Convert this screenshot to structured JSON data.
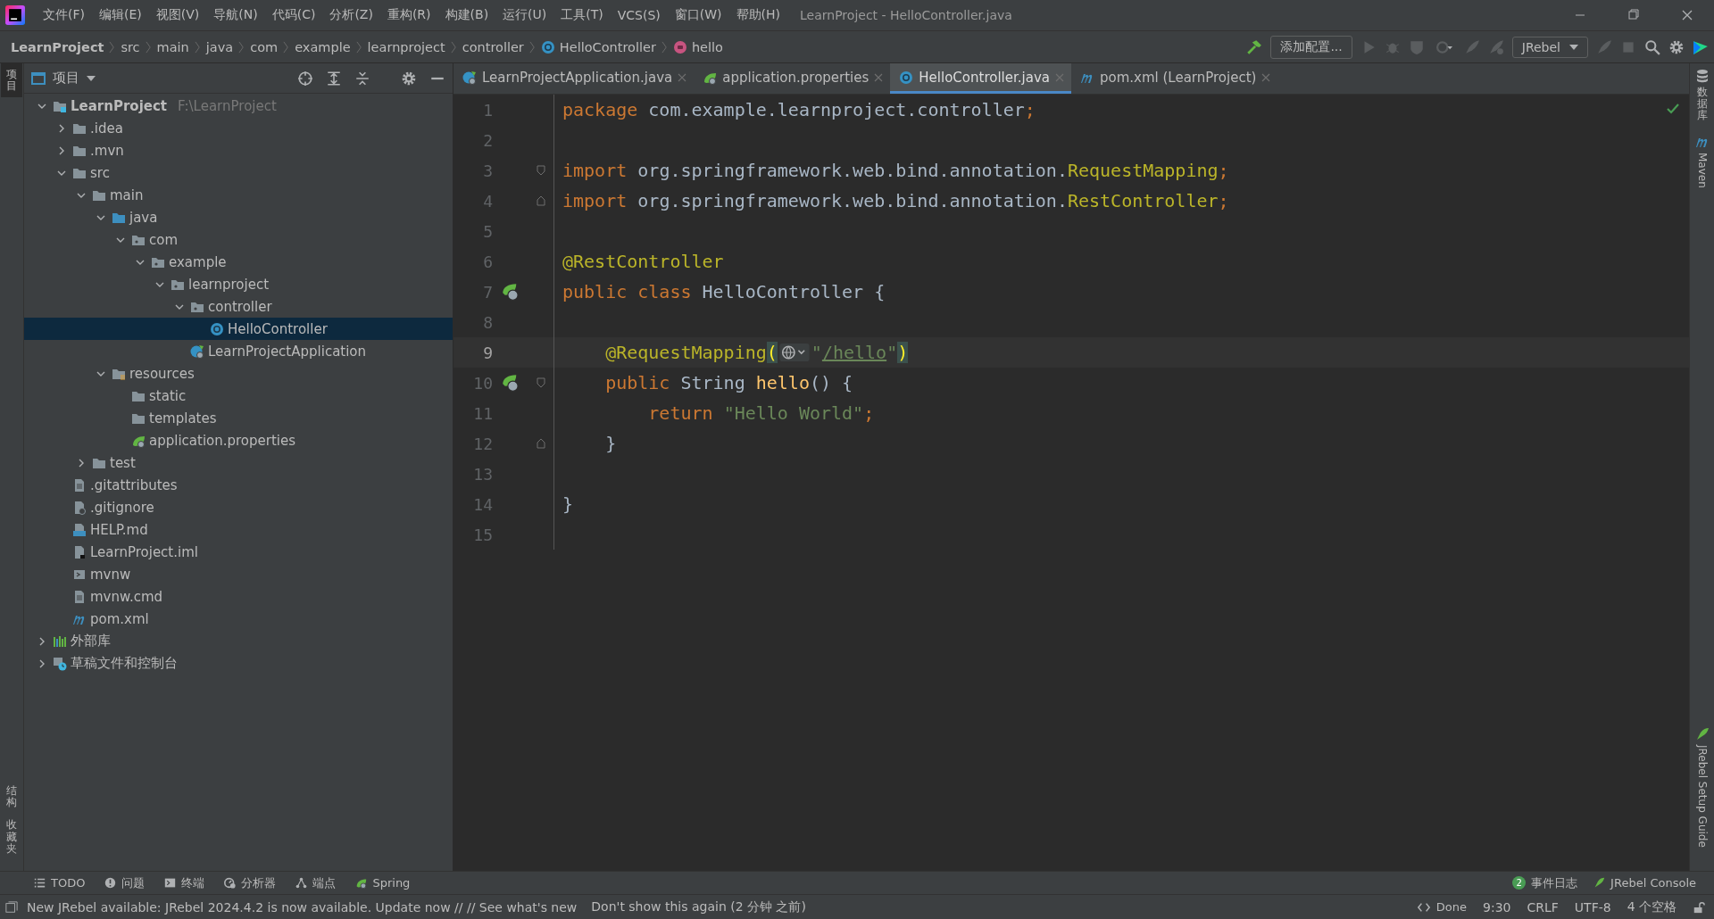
{
  "menu": [
    "文件(F)",
    "编辑(E)",
    "视图(V)",
    "导航(N)",
    "代码(C)",
    "分析(Z)",
    "重构(R)",
    "构建(B)",
    "运行(U)",
    "工具(T)",
    "VCS(S)",
    "窗口(W)",
    "帮助(H)"
  ],
  "window_title": "LearnProject - HelloController.java",
  "breadcrumbs": [
    {
      "label": "LearnProject",
      "kind": "project"
    },
    {
      "label": "src",
      "kind": "dir"
    },
    {
      "label": "main",
      "kind": "dir"
    },
    {
      "label": "java",
      "kind": "dir"
    },
    {
      "label": "com",
      "kind": "dir"
    },
    {
      "label": "example",
      "kind": "dir"
    },
    {
      "label": "learnproject",
      "kind": "dir"
    },
    {
      "label": "controller",
      "kind": "dir"
    },
    {
      "label": "HelloController",
      "kind": "class"
    },
    {
      "label": "hello",
      "kind": "method"
    }
  ],
  "toolbar": {
    "add_config": "添加配置...",
    "jrebel": "JRebel"
  },
  "left_strip_top": [
    {
      "label": "项目",
      "selected": true
    }
  ],
  "left_strip_bottom": [
    {
      "label": "结构",
      "selected": false
    },
    {
      "label": "收藏夹",
      "selected": false
    }
  ],
  "project_panel": {
    "title": "项目",
    "tree": [
      {
        "label": "LearnProject",
        "path": "F:\\LearnProject",
        "kind": "module",
        "expanded": true,
        "selected": false,
        "children": [
          {
            "label": ".idea",
            "kind": "folder",
            "expanded": false,
            "selected": false
          },
          {
            "label": ".mvn",
            "kind": "folder",
            "expanded": false,
            "selected": false
          },
          {
            "label": "src",
            "kind": "folder",
            "expanded": true,
            "selected": false,
            "children": [
              {
                "label": "main",
                "kind": "folder",
                "expanded": true,
                "selected": false,
                "children": [
                  {
                    "label": "java",
                    "kind": "source",
                    "expanded": true,
                    "selected": false,
                    "children": [
                      {
                        "label": "com",
                        "kind": "package",
                        "expanded": true,
                        "selected": false,
                        "children": [
                          {
                            "label": "example",
                            "kind": "package",
                            "expanded": true,
                            "selected": false,
                            "children": [
                              {
                                "label": "learnproject",
                                "kind": "package",
                                "expanded": true,
                                "selected": false,
                                "children": [
                                  {
                                    "label": "controller",
                                    "kind": "package",
                                    "expanded": true,
                                    "selected": false,
                                    "children": [
                                      {
                                        "label": "HelloController",
                                        "kind": "class",
                                        "selected": true
                                      }
                                    ]
                                  },
                                  {
                                    "label": "LearnProjectApplication",
                                    "kind": "spring-class",
                                    "selected": false
                                  }
                                ]
                              }
                            ]
                          }
                        ]
                      }
                    ]
                  },
                  {
                    "label": "resources",
                    "kind": "resources",
                    "expanded": true,
                    "selected": false,
                    "children": [
                      {
                        "label": "static",
                        "kind": "folder",
                        "selected": false
                      },
                      {
                        "label": "templates",
                        "kind": "folder",
                        "selected": false
                      },
                      {
                        "label": "application.properties",
                        "kind": "spring-config",
                        "selected": false
                      }
                    ]
                  }
                ]
              },
              {
                "label": "test",
                "kind": "folder",
                "expanded": false,
                "selected": false
              }
            ]
          },
          {
            "label": ".gitattributes",
            "kind": "text-file",
            "selected": false
          },
          {
            "label": ".gitignore",
            "kind": "ignore-file",
            "selected": false
          },
          {
            "label": "HELP.md",
            "kind": "md-file",
            "selected": false
          },
          {
            "label": "LearnProject.iml",
            "kind": "iml-file",
            "selected": false
          },
          {
            "label": "mvnw",
            "kind": "script-file",
            "selected": false
          },
          {
            "label": "mvnw.cmd",
            "kind": "text-file",
            "selected": false
          },
          {
            "label": "pom.xml",
            "kind": "maven-file",
            "selected": false
          }
        ]
      },
      {
        "label": "外部库",
        "kind": "library",
        "expanded": false,
        "selected": false
      },
      {
        "label": "草稿文件和控制台",
        "kind": "scratch",
        "expanded": false,
        "selected": false
      }
    ]
  },
  "tabs": [
    {
      "label": "LearnProjectApplication.java",
      "kind": "spring-class",
      "selected": false
    },
    {
      "label": "application.properties",
      "kind": "spring-config",
      "selected": false
    },
    {
      "label": "HelloController.java",
      "kind": "class",
      "selected": true
    },
    {
      "label": "pom.xml (LearnProject)",
      "kind": "maven-file",
      "selected": false
    }
  ],
  "editor": {
    "lines": [
      {
        "number": "1",
        "current": false,
        "tokens": [
          {
            "kind": "kw",
            "text": "package "
          },
          {
            "kind": "plain",
            "text": "com.example.learnproject.controller"
          },
          {
            "kind": "kw",
            "text": ";"
          }
        ]
      },
      {
        "number": "2",
        "current": false
      },
      {
        "number": "3",
        "current": false,
        "fold_start": true,
        "tokens": [
          {
            "kind": "kw",
            "text": "import "
          },
          {
            "kind": "plain",
            "text": "org.springframework.web.bind.annotation."
          },
          {
            "kind": "ann",
            "text": "RequestMapping"
          },
          {
            "kind": "kw",
            "text": ";"
          }
        ]
      },
      {
        "number": "4",
        "current": false,
        "fold_end": true,
        "tokens": [
          {
            "kind": "kw",
            "text": "import "
          },
          {
            "kind": "plain",
            "text": "org.springframework.web.bind.annotation."
          },
          {
            "kind": "ann",
            "text": "RestController"
          },
          {
            "kind": "kw",
            "text": ";"
          }
        ]
      },
      {
        "number": "5",
        "current": false
      },
      {
        "number": "6",
        "current": false,
        "tokens": [
          {
            "kind": "ann",
            "text": "@RestController"
          }
        ]
      },
      {
        "number": "7",
        "current": false,
        "bean_marker": true,
        "tokens": [
          {
            "kind": "kw",
            "text": "public class "
          },
          {
            "kind": "plain",
            "text": "HelloController {"
          }
        ]
      },
      {
        "number": "8",
        "current": false
      },
      {
        "number": "9",
        "current": true,
        "tokens": [
          {
            "kind": "ann",
            "text": "    @RequestMapping"
          },
          {
            "kind": "brace",
            "text": "("
          },
          {
            "kind": "inlay"
          },
          {
            "kind": "str",
            "text": "\""
          },
          {
            "kind": "link",
            "text": "/hello"
          },
          {
            "kind": "str",
            "text": "\""
          },
          {
            "kind": "brace",
            "text": ")"
          }
        ]
      },
      {
        "number": "10",
        "current": false,
        "bean_marker": true,
        "fold_start": true,
        "tokens": [
          {
            "kind": "kw",
            "text": "    public "
          },
          {
            "kind": "plain",
            "text": "String "
          },
          {
            "kind": "fn",
            "text": "hello"
          },
          {
            "kind": "plain",
            "text": "() {"
          }
        ]
      },
      {
        "number": "11",
        "current": false,
        "tokens": [
          {
            "kind": "kw",
            "text": "        return "
          },
          {
            "kind": "str",
            "text": "\"Hello World\""
          },
          {
            "kind": "kw",
            "text": ";"
          }
        ]
      },
      {
        "number": "12",
        "current": false,
        "fold_end": true,
        "tokens": [
          {
            "kind": "plain",
            "text": "    }"
          }
        ]
      },
      {
        "number": "13",
        "current": false
      },
      {
        "number": "14",
        "current": false,
        "tokens": [
          {
            "kind": "plain",
            "text": "}"
          }
        ]
      },
      {
        "number": "15",
        "current": false
      }
    ]
  },
  "right_strip": [
    {
      "label": "数据库",
      "kind": "database"
    },
    {
      "label": "Maven",
      "kind": "maven"
    },
    {
      "label": "JRebel Setup Guide",
      "kind": "jrebel"
    }
  ],
  "bottom_tools": [
    {
      "label": "TODO",
      "kind": "list"
    },
    {
      "label": "问题",
      "kind": "problems"
    },
    {
      "label": "终端",
      "kind": "terminal"
    },
    {
      "label": "分析器",
      "kind": "profiler"
    },
    {
      "label": "端点",
      "kind": "endpoints"
    },
    {
      "label": "Spring",
      "kind": "spring"
    }
  ],
  "bottom_right": [
    {
      "label": "事件日志",
      "badge": "2"
    },
    {
      "label": "JRebel Console"
    }
  ],
  "status": {
    "message": "New JRebel available: JRebel 2024.4.2 is now available. Update now // // See what's new",
    "dismiss": "Don't show this again (2 分钟 之前)",
    "done": "Done",
    "items": [
      "9:30",
      "CRLF",
      "UTF-8",
      "4 个空格"
    ]
  }
}
